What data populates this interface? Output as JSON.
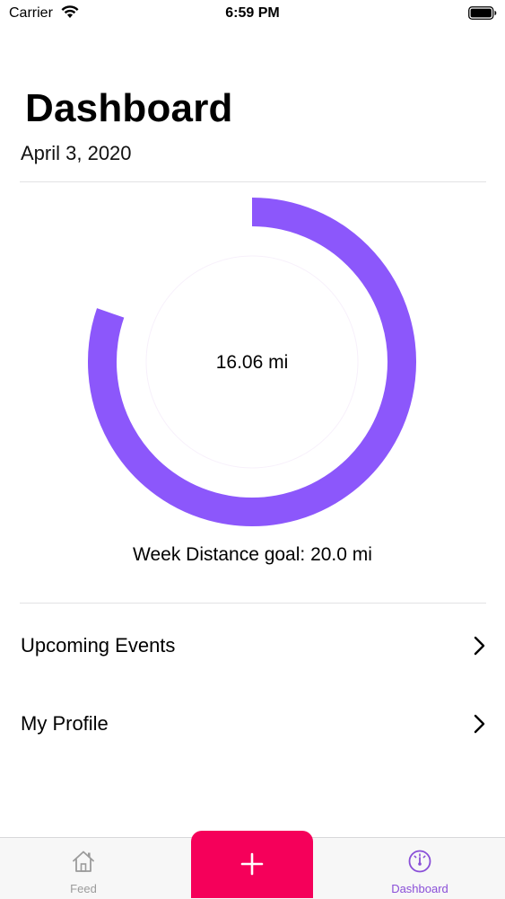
{
  "status_bar": {
    "carrier": "Carrier",
    "time": "6:59 PM"
  },
  "header": {
    "title": "Dashboard",
    "date": "April 3, 2020"
  },
  "progress": {
    "value_label": "16.06 mi",
    "goal_label": "Week Distance goal: 20.0 mi",
    "fraction": 0.803,
    "color": "#8c57fb"
  },
  "menu": {
    "items": [
      {
        "label": "Upcoming Events"
      },
      {
        "label": "My Profile"
      }
    ]
  },
  "tab_bar": {
    "tabs": [
      {
        "label": "Feed",
        "icon": "home-icon",
        "active": false
      },
      {
        "label": "Dashboard",
        "icon": "gauge-icon",
        "active": true
      }
    ],
    "add_button_icon": "plus-icon",
    "add_button_color": "#f5005a",
    "active_color": "#8a4fd8",
    "inactive_color": "#9b9b9b"
  }
}
